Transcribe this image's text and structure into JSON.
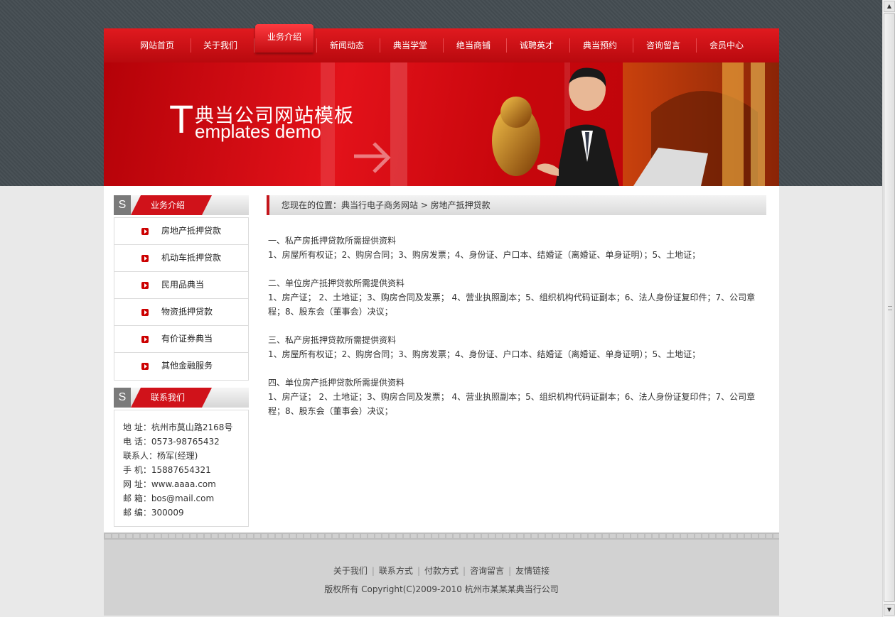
{
  "nav": {
    "items": [
      {
        "label": "网站首页"
      },
      {
        "label": "关于我们"
      },
      {
        "label": "业务介绍",
        "active": true
      },
      {
        "label": "新闻动态"
      },
      {
        "label": "典当学堂"
      },
      {
        "label": "绝当商铺"
      },
      {
        "label": "诚聘英才"
      },
      {
        "label": "典当预约"
      },
      {
        "label": "咨询留言"
      },
      {
        "label": "会员中心"
      }
    ]
  },
  "banner": {
    "title_cn": "典当公司网站模板",
    "title_en_initial": "T",
    "title_en_rest": "emplates demo"
  },
  "sidebar": {
    "s_letter": "S",
    "business": {
      "heading": "业务介绍",
      "items": [
        {
          "label": "房地产抵押贷款"
        },
        {
          "label": "机动车抵押贷款"
        },
        {
          "label": "民用品典当"
        },
        {
          "label": "物资抵押贷款"
        },
        {
          "label": "有价证券典当"
        },
        {
          "label": "其他金融服务"
        }
      ]
    },
    "contact": {
      "heading": "联系我们",
      "lines": [
        "地 址：杭州市莫山路2168号",
        "电 话：0573-98765432",
        "联系人：杨军(经理)",
        "手 机：15887654321",
        "网 址：www.aaaa.com",
        "邮 箱：bos@mail.com",
        "邮 编：300009"
      ]
    }
  },
  "main": {
    "breadcrumb": "您现在的位置：典当行电子商务网站  > 房地产抵押贷款",
    "sections": [
      {
        "title": "一、私产房抵押贷款所需提供资料",
        "body": "1、房屋所有权证；2、购房合同；3、购房发票；4、身份证、户口本、结婚证（离婚证、单身证明）；5、土地证；"
      },
      {
        "title": "二、单位房产抵押贷款所需提供资料",
        "body": "1、房产证； 2、土地证；3、购房合同及发票； 4、营业执照副本；5、组织机构代码证副本；6、法人身份证复印件；7、公司章程；8、股东会（董事会）决议；"
      },
      {
        "title": "三、私产房抵押贷款所需提供资料",
        "body": "1、房屋所有权证；2、购房合同；3、购房发票；4、身份证、户口本、结婚证（离婚证、单身证明）；5、土地证；"
      },
      {
        "title": "四、单位房产抵押贷款所需提供资料",
        "body": "1、房产证； 2、土地证；3、购房合同及发票； 4、营业执照副本；5、组织机构代码证副本；6、法人身份证复印件；7、公司章程；8、股东会（董事会）决议；"
      }
    ]
  },
  "footer": {
    "links": [
      {
        "label": "关于我们"
      },
      {
        "label": "联系方式"
      },
      {
        "label": "付款方式"
      },
      {
        "label": "咨询留言"
      },
      {
        "label": "友情链接"
      }
    ],
    "separator": "|",
    "copyright": "版权所有  Copyright(C)2009-2010 杭州市某某某典当行公司"
  },
  "colors": {
    "brand_red": "#c4161c",
    "nav_red": "#d0121a",
    "footer_gray": "#d2d2d2",
    "page_dark": "#454d52"
  },
  "icons": [
    "arrow-right-icon",
    "bullet-arrow-icon",
    "scroll-up-icon",
    "scroll-down-icon"
  ]
}
